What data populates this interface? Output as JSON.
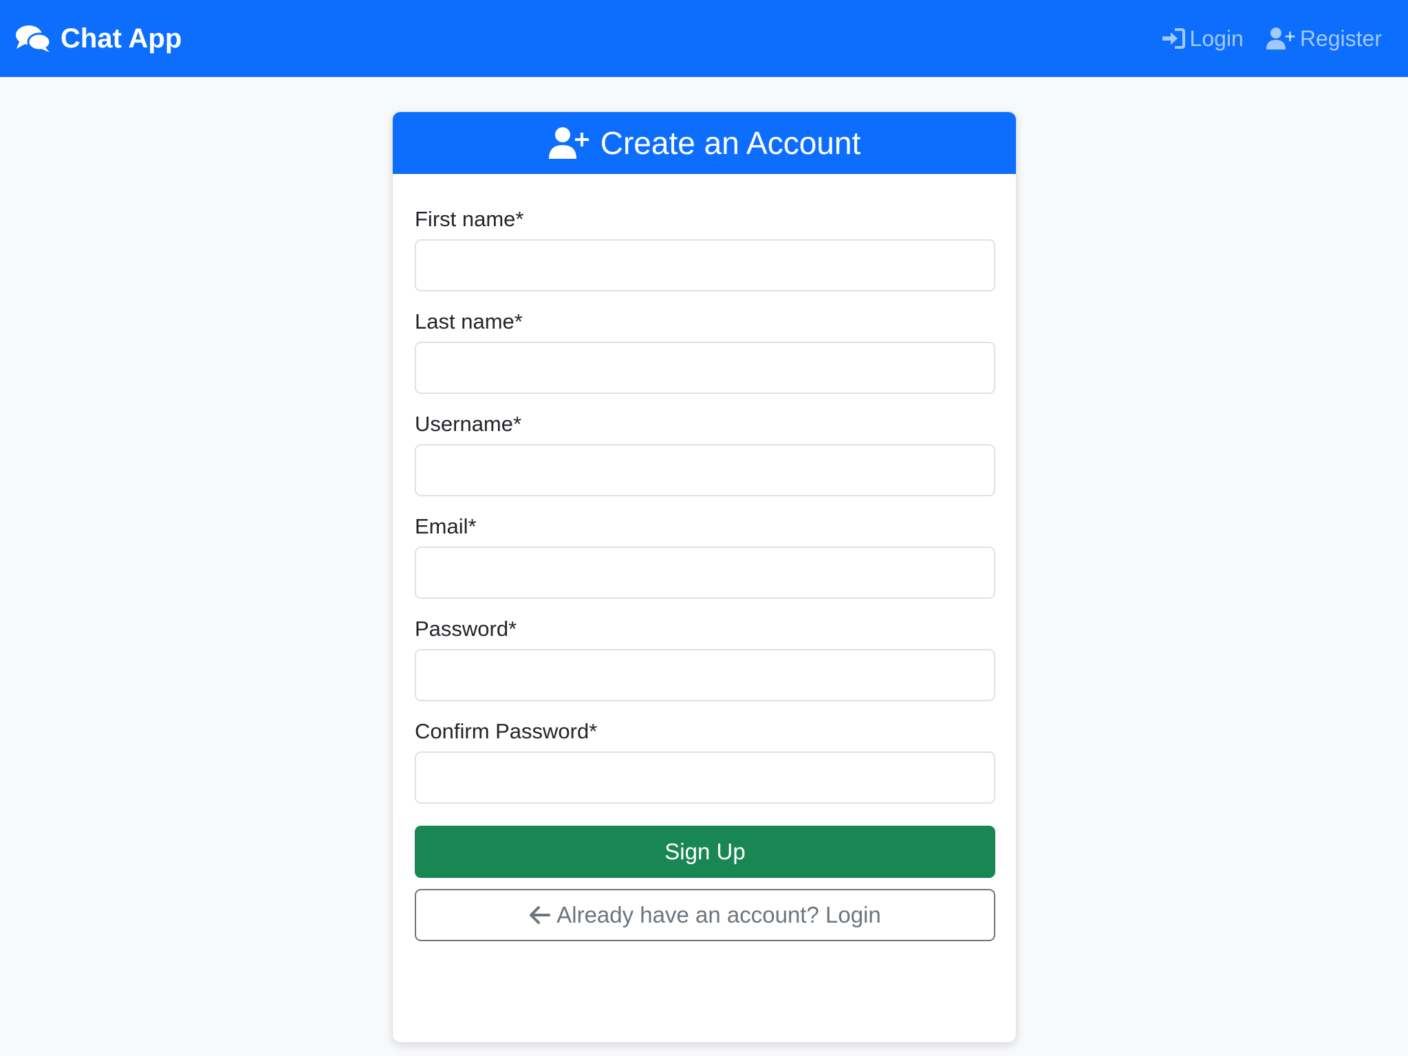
{
  "navbar": {
    "brand": "Chat App",
    "brand_icon": "comments-icon",
    "links": [
      {
        "label": "Login",
        "icon": "sign-in-icon"
      },
      {
        "label": "Register",
        "icon": "user-plus-icon"
      }
    ]
  },
  "card": {
    "title": "Create an Account",
    "title_icon": "user-plus-icon",
    "fields": [
      {
        "label": "First name*",
        "value": "",
        "placeholder": ""
      },
      {
        "label": "Last name*",
        "value": "",
        "placeholder": ""
      },
      {
        "label": "Username*",
        "value": "",
        "placeholder": ""
      },
      {
        "label": "Email*",
        "value": "",
        "placeholder": ""
      },
      {
        "label": "Password*",
        "value": "",
        "placeholder": ""
      },
      {
        "label": "Confirm Password*",
        "value": "",
        "placeholder": ""
      }
    ],
    "signup_label": "Sign Up",
    "login_label": "Already have an account? Login",
    "login_icon": "arrow-left-icon"
  },
  "colors": {
    "primary": "#0d6efd",
    "success": "#198754",
    "secondary": "#6c757d",
    "background": "#f8f9fa"
  }
}
